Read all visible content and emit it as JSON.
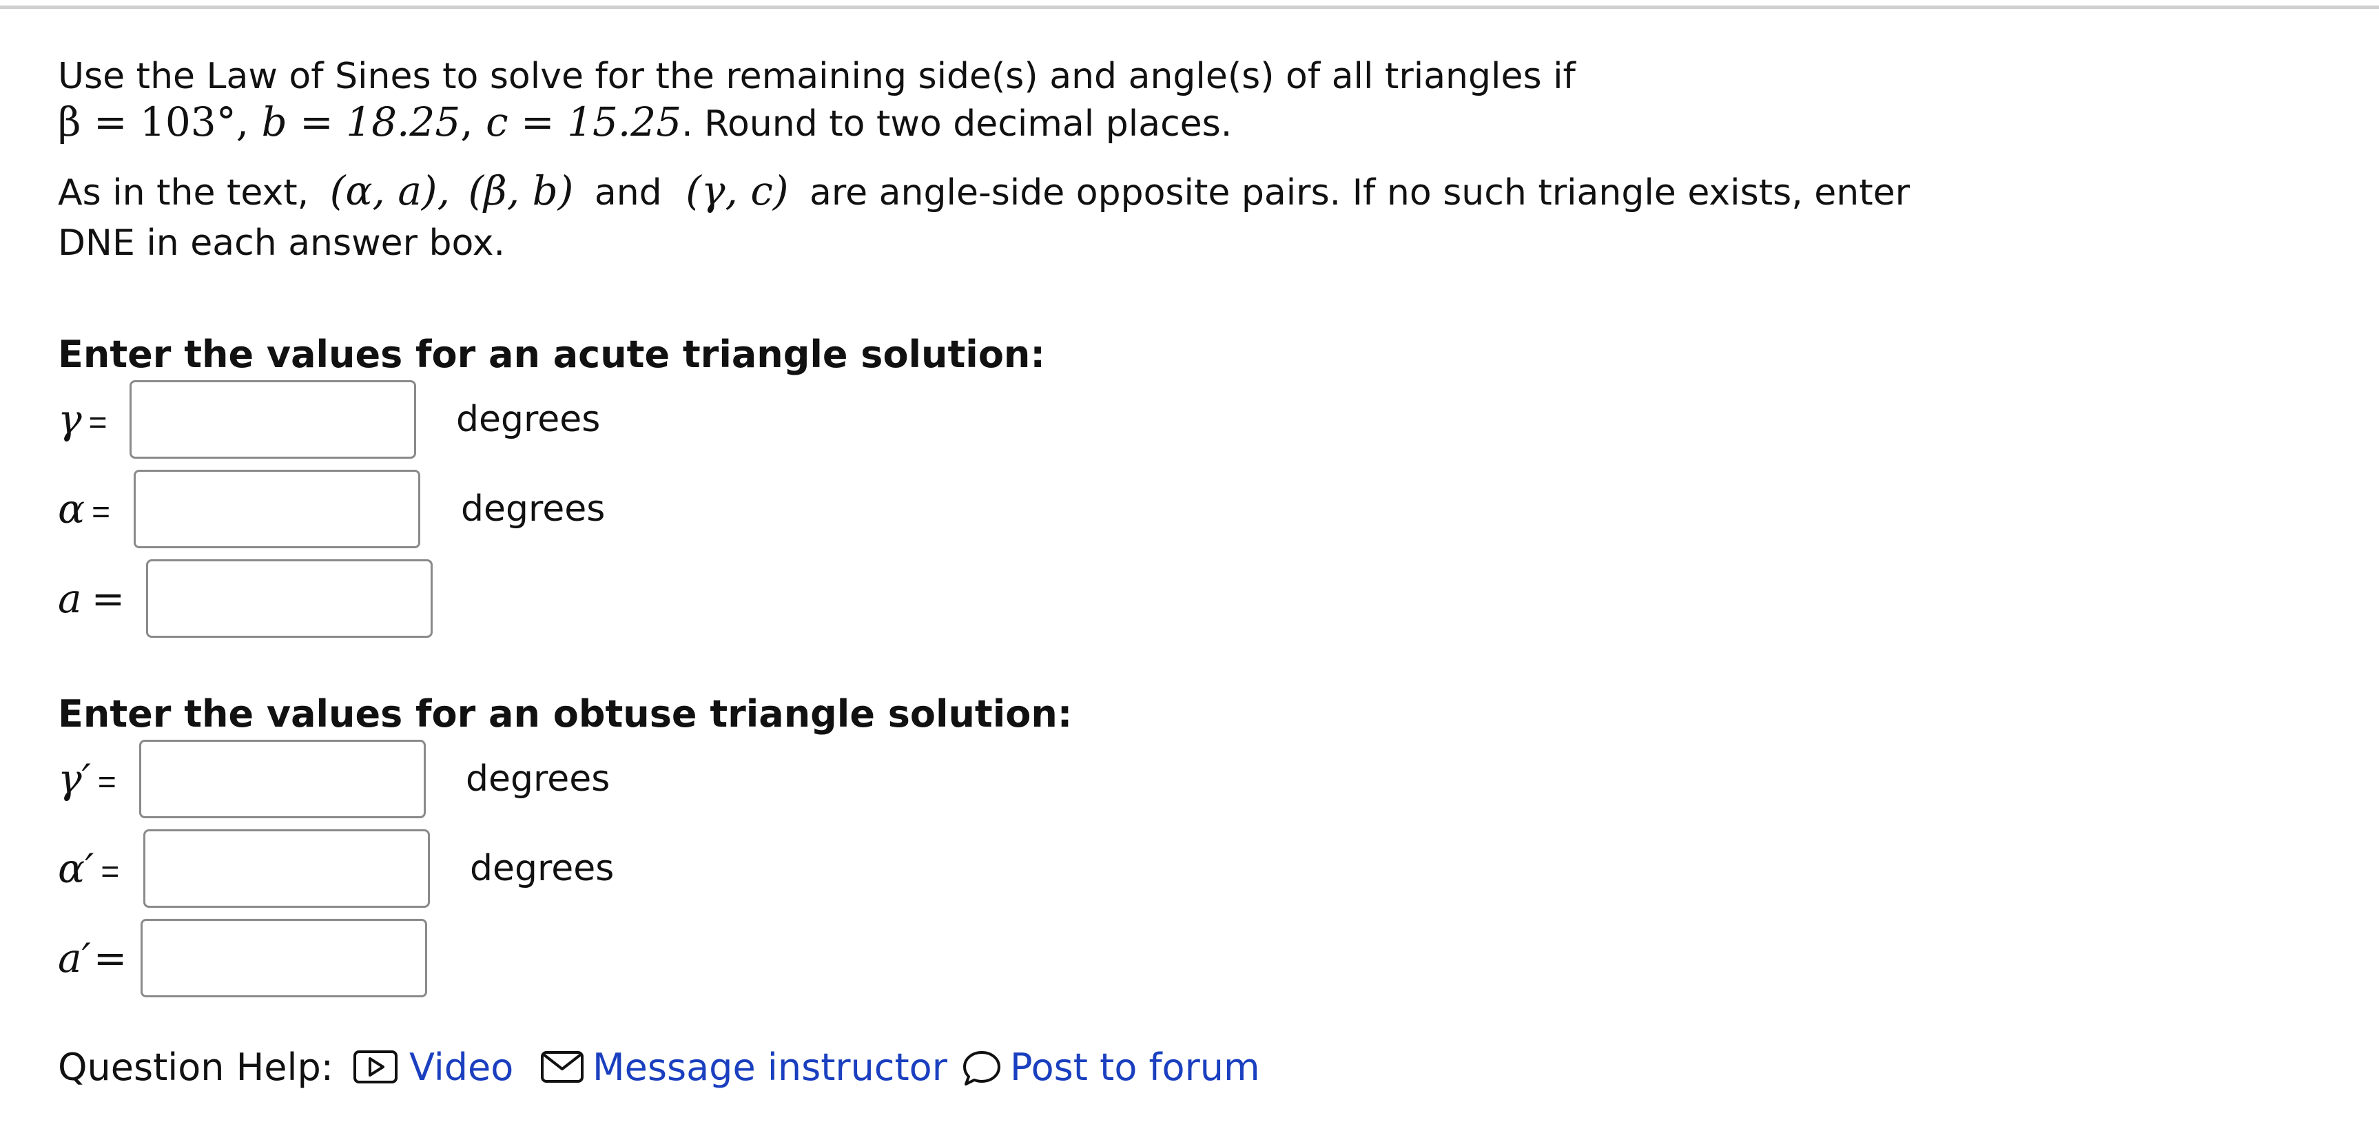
{
  "question": {
    "line1": "Use the Law of Sines to solve for the remaining side(s) and angle(s) of all triangles if",
    "given_beta": "β = 103°",
    "given_b": "b = 18.25",
    "given_c": "c = 15.25",
    "round_text": ". Round to two decimal places.",
    "pairs_prefix": "As in the text,",
    "pair1": "(α, a),",
    "pair2": "(β, b)",
    "pairs_and": "and",
    "pair3": "(γ, c)",
    "pairs_suffix": "are angle-side opposite pairs. If no such triangle exists, enter",
    "line_dne": "DNE in each answer box."
  },
  "acute": {
    "title": "Enter the values for an acute triangle solution:",
    "gamma_symbol": "γ",
    "alpha_symbol": "α",
    "a_symbol": "a",
    "equals": "=",
    "gamma_value": "",
    "alpha_value": "",
    "a_value": "",
    "unit": "degrees"
  },
  "obtuse": {
    "title": "Enter the values for an obtuse triangle solution:",
    "gamma_symbol": "γ′",
    "alpha_symbol": "α′",
    "a_symbol": "a′",
    "equals": "=",
    "gamma_value": "",
    "alpha_value": "",
    "a_value": "",
    "unit": "degrees"
  },
  "help": {
    "label": "Question Help:",
    "video": "Video",
    "message": "Message instructor",
    "forum": "Post to forum",
    "video_icon": "video-play-icon",
    "message_icon": "envelope-icon",
    "forum_icon": "speech-bubble-icon",
    "link_color": "#1a3fbf"
  }
}
